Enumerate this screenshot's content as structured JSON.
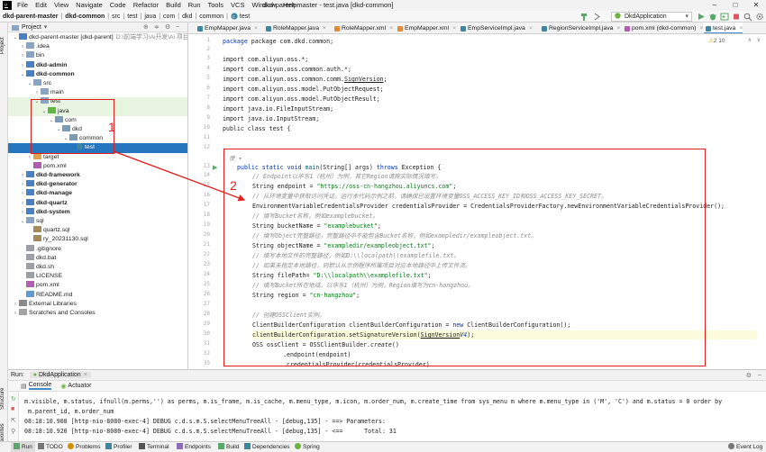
{
  "menubar": {
    "items": [
      "File",
      "Edit",
      "View",
      "Navigate",
      "Code",
      "Refactor",
      "Build",
      "Run",
      "Tools",
      "VCS",
      "Window",
      "Help"
    ],
    "title": "dkd-parent-master - test.java [dkd-common]"
  },
  "navbar": {
    "crumbs": [
      "dkd-parent-master",
      "dkd-common",
      "src",
      "test",
      "java",
      "com",
      "dkd",
      "common",
      "test"
    ],
    "run_config": "DkdApplication"
  },
  "sidebar": {
    "project_label": "Project",
    "structure_label": "Structure",
    "favorites_label": "Favorites"
  },
  "project": {
    "header": "Project",
    "tree": [
      {
        "label": "dkd-parent-master [dkd-parent]",
        "muted": "D:\\前端学习\\Ai开发\\Ai 项目",
        "arrow": "v",
        "icon": "module",
        "depth": 0
      },
      {
        "label": ".idea",
        "arrow": ">",
        "icon": "folder",
        "depth": 1
      },
      {
        "label": "bin",
        "arrow": ">",
        "icon": "folder",
        "depth": 1
      },
      {
        "label": "dkd-admin",
        "arrow": ">",
        "icon": "module",
        "depth": 1,
        "bold": true
      },
      {
        "label": "dkd-common",
        "arrow": "v",
        "icon": "module",
        "depth": 1,
        "bold": true
      },
      {
        "label": "src",
        "arrow": "v",
        "icon": "folder",
        "depth": 2
      },
      {
        "label": "main",
        "arrow": ">",
        "icon": "folder",
        "depth": 3
      },
      {
        "label": "test",
        "arrow": "v",
        "icon": "folder",
        "depth": 3,
        "green": true
      },
      {
        "label": "java",
        "arrow": "v",
        "icon": "greenfolder",
        "depth": 4,
        "green": true
      },
      {
        "label": "com",
        "arrow": "v",
        "icon": "package",
        "depth": 5
      },
      {
        "label": "dkd",
        "arrow": "v",
        "icon": "package",
        "depth": 6
      },
      {
        "label": "common",
        "arrow": "v",
        "icon": "package",
        "depth": 7
      },
      {
        "label": "test",
        "arrow": "",
        "icon": "class",
        "depth": 8,
        "selected": true
      },
      {
        "label": "target",
        "arrow": ">",
        "icon": "orangefolder",
        "depth": 2
      },
      {
        "label": "pom.xml",
        "arrow": "",
        "icon": "maven",
        "depth": 2
      },
      {
        "label": "dkd-framework",
        "arrow": ">",
        "icon": "module",
        "depth": 1,
        "bold": true
      },
      {
        "label": "dkd-generator",
        "arrow": ">",
        "icon": "module",
        "depth": 1,
        "bold": true
      },
      {
        "label": "dkd-manage",
        "arrow": ">",
        "icon": "module",
        "depth": 1,
        "bold": true
      },
      {
        "label": "dkd-quartz",
        "arrow": ">",
        "icon": "module",
        "depth": 1,
        "bold": true
      },
      {
        "label": "dkd-system",
        "arrow": ">",
        "icon": "module",
        "depth": 1,
        "bold": true
      },
      {
        "label": "sql",
        "arrow": "v",
        "icon": "folder",
        "depth": 1
      },
      {
        "label": "quartz.sql",
        "arrow": "",
        "icon": "sql",
        "depth": 2
      },
      {
        "label": "ry_20231130.sql",
        "arrow": "",
        "icon": "sql",
        "depth": 2
      },
      {
        "label": ".gitignore",
        "arrow": "",
        "icon": "file",
        "depth": 1
      },
      {
        "label": "dkd.bat",
        "arrow": "",
        "icon": "file",
        "depth": 1
      },
      {
        "label": "dkd.sh",
        "arrow": "",
        "icon": "file",
        "depth": 1
      },
      {
        "label": "LICENSE",
        "arrow": "",
        "icon": "file",
        "depth": 1
      },
      {
        "label": "pom.xml",
        "arrow": "",
        "icon": "maven",
        "depth": 1
      },
      {
        "label": "README.md",
        "arrow": "",
        "icon": "md",
        "depth": 1
      },
      {
        "label": "External Libraries",
        "arrow": ">",
        "icon": "lib",
        "depth": 0
      },
      {
        "label": "Scratches and Consoles",
        "arrow": ">",
        "icon": "scratch",
        "depth": 0
      }
    ]
  },
  "editor": {
    "tabs": [
      "EmpMapper.java",
      "RoleMapper.java",
      "RoleMapper.xml",
      "EmpMapper.xml",
      "EmpServiceImpl.java",
      "RegionServiceImpl.java",
      "pom.xml (dkd-common)",
      "test.java"
    ],
    "inspection": "2  10",
    "line_numbers": [
      "1",
      "2",
      "3",
      "4",
      "5",
      "6",
      "7",
      "8",
      "9",
      "10",
      "11",
      "12",
      "13",
      "14",
      "15",
      "16",
      "17",
      "18",
      "19",
      "20",
      "21",
      "22",
      "23",
      "24",
      "25",
      "26",
      "27",
      "28",
      "29",
      "30",
      "31",
      "32",
      "33",
      "34",
      "35",
      "36",
      "37"
    ],
    "code": {
      "l1": "package com.dkd.common;",
      "l3": "import com.aliyun.oss.*;",
      "l4": "import com.aliyun.oss.common.auth.*;",
      "l5a": "import com.aliyun.oss.common.comm.",
      "l5b": "SignVersion",
      ";": ";",
      "l6": "import com.aliyun.oss.model.PutObjectRequest;",
      "l7": "import com.aliyun.oss.model.PutObjectResult;",
      "l8": "import java.io.FileInputStream;",
      "l9": "import java.io.InputStream;",
      "l10": "public class test {",
      "hint": "使 ▾",
      "l13kw": "public static void ",
      "l13fn": "main",
      "l13rest": "(String[] args) ",
      "l13kw2": "throws ",
      "l13end": "Exception {",
      "c1": "// Endpoint以华东1（杭州）为例，其它Region请按实际情况填写。",
      "s1a": "String endpoint = ",
      "s1b": "\"https://oss-cn-hangzhou.aliyuncs.com\"",
      "c2": "// 从环境变量中获取访问凭证。运行本代码示例之前，请确保已设置环境变量OSS_ACCESS_KEY_ID和OSS_ACCESS_KEY_SECRET。",
      "s2": "EnvironmentVariableCredentialsProvider credentialsProvider = CredentialsProviderFactory.newEnvironmentVariableCredentialsProvider();",
      "c3": "// 填写Bucket名称，例如examplebucket。",
      "s3a": "String bucketName = ",
      "s3b": "\"examplebucket\"",
      "c4": "// 填写Object完整路径，完整路径中不能包含Bucket名称，例如exampledir/exampleobject.txt。",
      "s4a": "String objectName = ",
      "s4b": "\"exampledir/exampleobject.txt\"",
      "c5": "// 填写本地文件的完整路径，例如D:\\\\localpath\\\\examplefile.txt。",
      "c6": "// 如果未指定本地路径，则默认从示例程序所属项目对应本地路径中上传文件流。",
      "s5a": "String filePath= ",
      "s5b": "\"D:\\\\localpath\\\\examplefile.txt\"",
      "c7": "// 填写Bucket所在地域。以华东1（杭州）为例，Region填写为cn-hangzhou。",
      "s6a": "String region = ",
      "s6b": "\"cn-hangzhou\"",
      "c8": "// 创建OSSClient实例。",
      "s7a": "ClientBuilderConfiguration clientBuilderConfiguration = ",
      "s7kw": "new ",
      "s7b": "ClientBuilderConfiguration();",
      "s8a": "clientBuilderConfiguration.setSignatureVersion(",
      "s8b": "SignVersion",
      ".": ".",
      "s8c": "V4",
      ")": ");",
      "s9a": "OSS ossClient = OSSClientBuilder.",
      "s9b": "create",
      "s9c": "()",
      "s10": ".endpoint(endpoint)",
      "s11": ".credentialsProvider(credentialsProvider)"
    },
    "annotations": {
      "n1": "1",
      "n2": "2"
    }
  },
  "run": {
    "label": "Run:",
    "app": "DkdApplication",
    "console_tab": "Console",
    "actuator_tab": "Actuator",
    "logs": [
      "m.visible, m.status, ifnull(m.perms,'') as perms, m.is_frame, m.is_cache, m.menu_type, m.icon, m.order_num, m.create_time from sys_menu m where m.menu_type in ('M', 'C') and m.status = 0 order by",
      " m.parent_id, m.order_num",
      "08:18:10.908 [http-nio-8080-exec-4] DEBUG c.d.s.m.S.selectMenuTreeAll - [debug,135] - ==> Parameters:",
      "08:18:10.920 [http-nio-8080-exec-4] DEBUG c.d.s.m.S.selectMenuTreeAll - [debug,135] - <==      Total: 31"
    ]
  },
  "bottombar": {
    "items": [
      "Run",
      "TODO",
      "Problems",
      "Profiler",
      "Terminal",
      "Endpoints",
      "Build",
      "Dependencies",
      "Spring"
    ],
    "event_log": "Event Log"
  },
  "colors": {
    "accent": "#2675bf",
    "annotation": "#e02020",
    "keyword": "#0033b3",
    "string": "#067d17",
    "comment": "#8c8c8c"
  }
}
